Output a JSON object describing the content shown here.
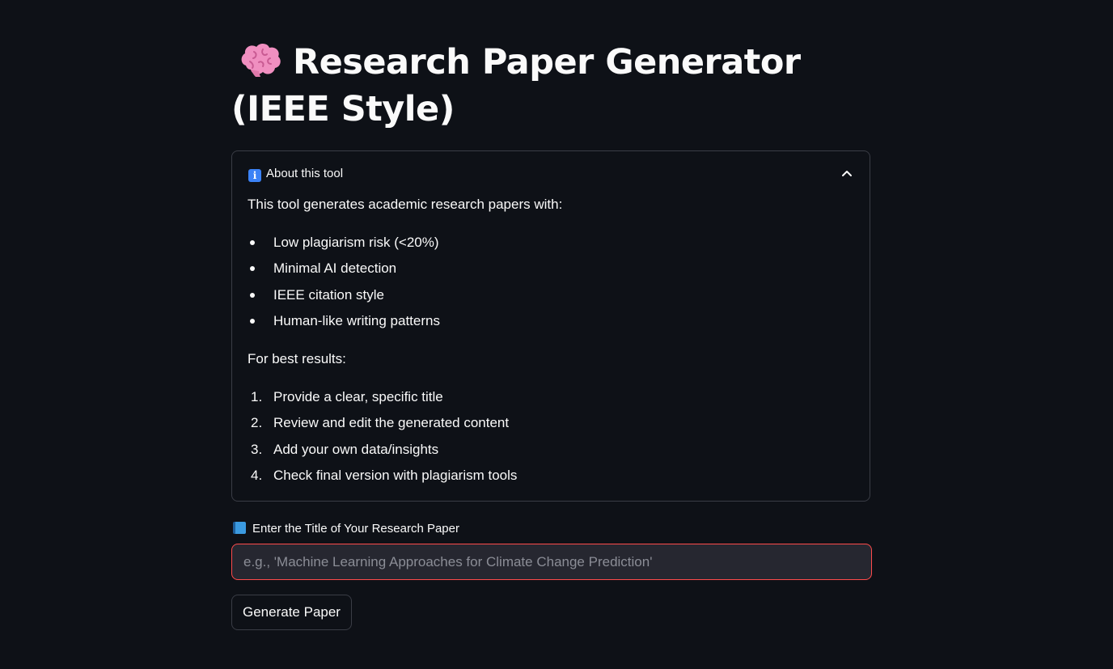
{
  "page": {
    "title": "Research Paper Generator (IEEE Style)",
    "title_icon": "brain-icon"
  },
  "about": {
    "header_label": "About this tool",
    "header_icon": "info-icon",
    "toggle_icon": "chevron-up-icon",
    "intro": "This tool generates academic research papers with:",
    "features": [
      "Low plagiarism risk (<20%)",
      "Minimal AI detection",
      "IEEE citation style",
      "Human-like writing patterns"
    ],
    "best_results_label": "For best results:",
    "steps": [
      {
        "num": "1.",
        "text": "Provide a clear, specific title"
      },
      {
        "num": "2.",
        "text": "Review and edit the generated content"
      },
      {
        "num": "3.",
        "text": "Add your own data/insights"
      },
      {
        "num": "4.",
        "text": "Check final version with plagiarism tools"
      }
    ]
  },
  "form": {
    "input_label": "Enter the Title of Your Research Paper",
    "input_icon": "book-icon",
    "input_value": "",
    "input_placeholder": "e.g., 'Machine Learning Approaches for Climate Change Prediction'",
    "submit_label": "Generate Paper"
  },
  "colors": {
    "background": "#0e1117",
    "text": "#fafafa",
    "input_border_focus": "#ff4b4b",
    "input_background": "#262730",
    "border": "#3a3d46"
  }
}
